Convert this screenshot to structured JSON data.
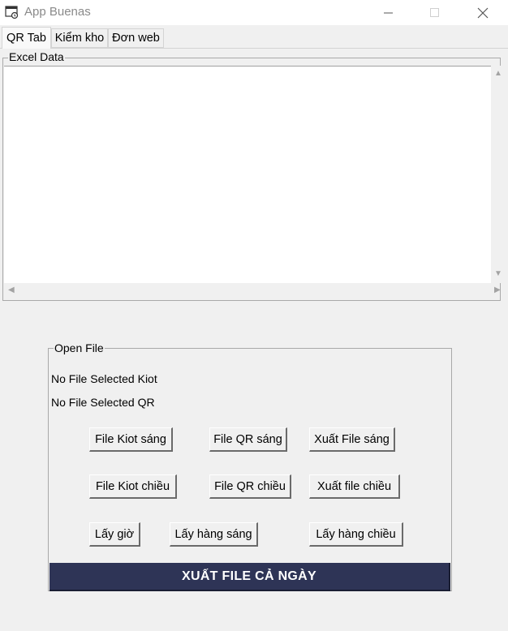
{
  "window": {
    "title": "App Buenas",
    "minimize_icon": "minimize-icon",
    "maximize_icon": "maximize-icon",
    "close_icon": "close-icon"
  },
  "tabs": [
    {
      "label": "QR Tab",
      "active": true
    },
    {
      "label": "Kiểm kho",
      "active": false
    },
    {
      "label": "Đơn web",
      "active": false
    }
  ],
  "excel": {
    "legend": "Excel Data"
  },
  "open_file": {
    "legend": "Open File",
    "status_kiot": "No File Selected Kiot",
    "status_qr": "No File Selected QR",
    "buttons": {
      "kiot_morning": "File Kiot sáng",
      "qr_morning": "File QR sáng",
      "export_morning": "Xuất File sáng",
      "kiot_afternoon": "File Kiot chiều",
      "qr_afternoon": "File QR chiều",
      "export_afternoon": "Xuất file chiều",
      "get_time": "Lấy giờ",
      "get_goods_morning": "Lấy hàng sáng",
      "get_goods_afternoon": "Lấy hàng chiều"
    },
    "export_all": "XUẤT FILE CẢ NGÀY"
  },
  "colors": {
    "export_all_bg": "#2e3456",
    "window_bg": "#f0f0f0"
  }
}
